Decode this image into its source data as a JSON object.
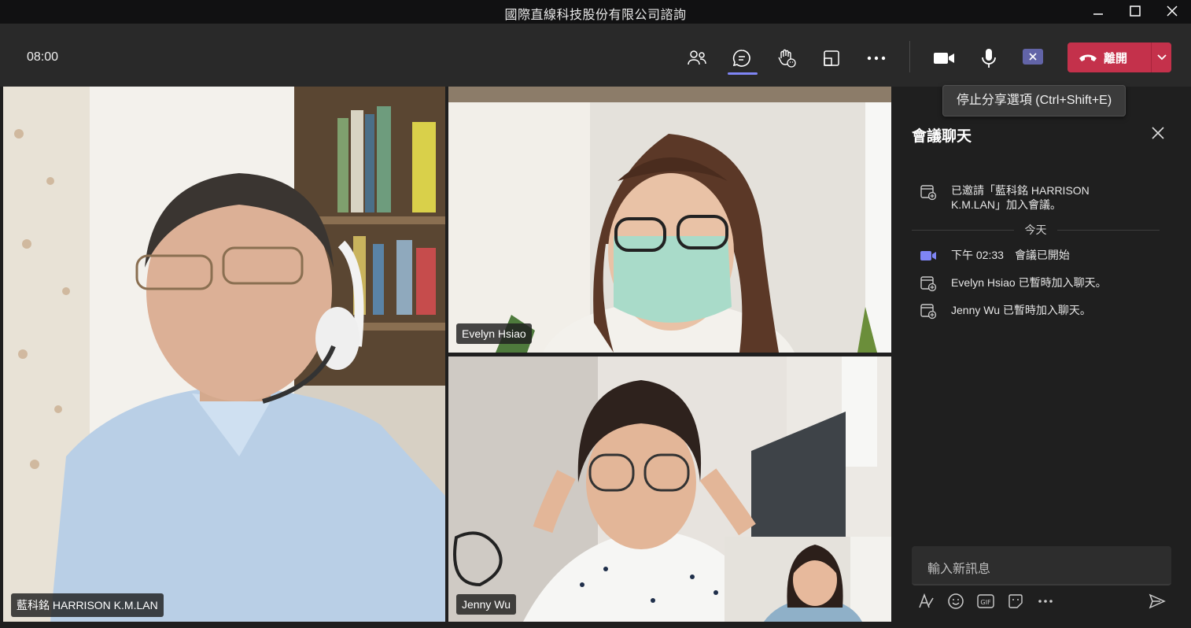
{
  "window": {
    "title": "國際直線科技股份有限公司諮詢"
  },
  "toolbar": {
    "timer": "08:00",
    "buttons": [
      "participants-icon",
      "chat-icon",
      "reactions-icon",
      "rooms-icon",
      "more-icon",
      "camera-icon",
      "mic-icon",
      "share-stop-icon"
    ],
    "leave_label": "離開",
    "tooltip": "停止分享選項 (Ctrl+Shift+E)"
  },
  "videos": {
    "main": {
      "name": "藍科銘 HARRISON K.M.LAN"
    },
    "top_right": {
      "name": "Evelyn Hsiao"
    },
    "bottom_right": {
      "name": "Jenny Wu"
    }
  },
  "chat": {
    "title": "會議聊天",
    "invite_line1": "已邀請「藍科銘 HARRISON",
    "invite_line2": "K.M.LAN」加入會議。",
    "day_separator": "今天",
    "meeting_time": "下午 02:33",
    "meeting_started": "會議已開始",
    "joined_evelyn": "Evelyn Hsiao 已暫時加入聊天。",
    "joined_jenny": "Jenny Wu 已暫時加入聊天。",
    "compose_placeholder": "輸入新訊息"
  },
  "colors": {
    "accent": "#6264a7",
    "leave": "#c4314b",
    "toolbar": "#292929",
    "background": "#1f1f1f"
  }
}
